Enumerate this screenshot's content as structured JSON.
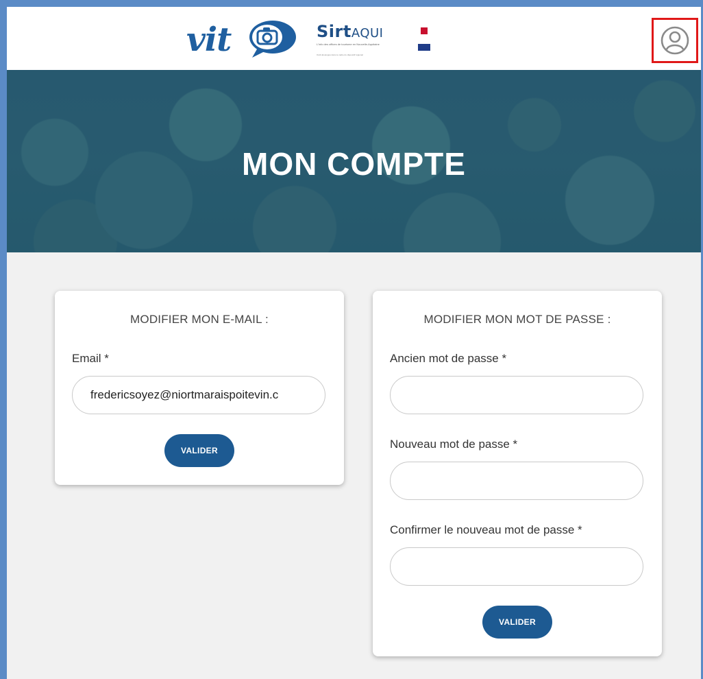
{
  "header": {
    "vit_logo_text": "vit",
    "sirt_logo_main": "Sirt",
    "sirt_logo_aqui": "AQUI",
    "sirt_logo_sub": "L'info des offices de tourisme en Nouvelle-Aquitaine",
    "sirt_logo_tagline": "Outil développé dans le cadre du dispositif régional",
    "account_icon": "user-circle-icon"
  },
  "hero": {
    "title": "MON COMPTE"
  },
  "email_card": {
    "title": "MODIFIER MON E-MAIL :",
    "email_label": "Email *",
    "email_value": "fredericsoyez@niortmaraispoitevin.c",
    "submit_label": "VALIDER"
  },
  "password_card": {
    "title": "MODIFIER MON MOT DE PASSE :",
    "old_label": "Ancien mot de passe *",
    "new_label": "Nouveau mot de passe *",
    "confirm_label": "Confirmer le nouveau mot de passe *",
    "old_value": "",
    "new_value": "",
    "confirm_value": "",
    "submit_label": "VALIDER"
  },
  "colors": {
    "frame_border": "#5b8bc6",
    "primary_button": "#1d5a92",
    "highlight_box": "#e01818",
    "page_background": "#f1f1f1"
  }
}
